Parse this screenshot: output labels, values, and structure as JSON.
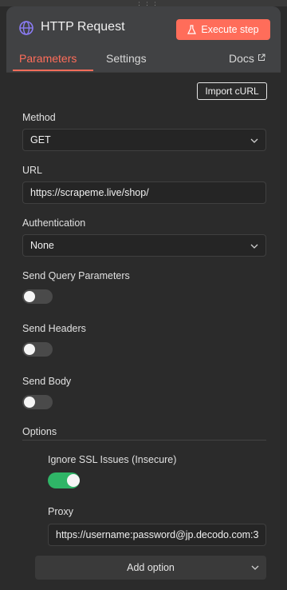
{
  "header": {
    "title": "HTTP Request",
    "execute_label": "Execute step",
    "drag_glyph": "⋮⋮⋮"
  },
  "tabs": {
    "parameters": "Parameters",
    "settings": "Settings",
    "docs": "Docs"
  },
  "import_curl_label": "Import cURL",
  "method": {
    "label": "Method",
    "value": "GET"
  },
  "url": {
    "label": "URL",
    "value": "https://scrapeme.live/shop/"
  },
  "authentication": {
    "label": "Authentication",
    "value": "None"
  },
  "send_query": {
    "label": "Send Query Parameters",
    "enabled": false
  },
  "send_headers": {
    "label": "Send Headers",
    "enabled": false
  },
  "send_body": {
    "label": "Send Body",
    "enabled": false
  },
  "options": {
    "label": "Options",
    "ignore_ssl": {
      "label": "Ignore SSL Issues (Insecure)",
      "enabled": true
    },
    "proxy": {
      "label": "Proxy",
      "value": "https://username:password@jp.decodo.com:3"
    },
    "add_option_label": "Add option"
  },
  "colors": {
    "accent": "#ff6d5a",
    "toggle_on": "#2fb567",
    "globe": "#8b7cf6"
  },
  "icons": [
    "globe-icon",
    "flask-icon",
    "external-link-icon",
    "chevron-down-icon"
  ]
}
